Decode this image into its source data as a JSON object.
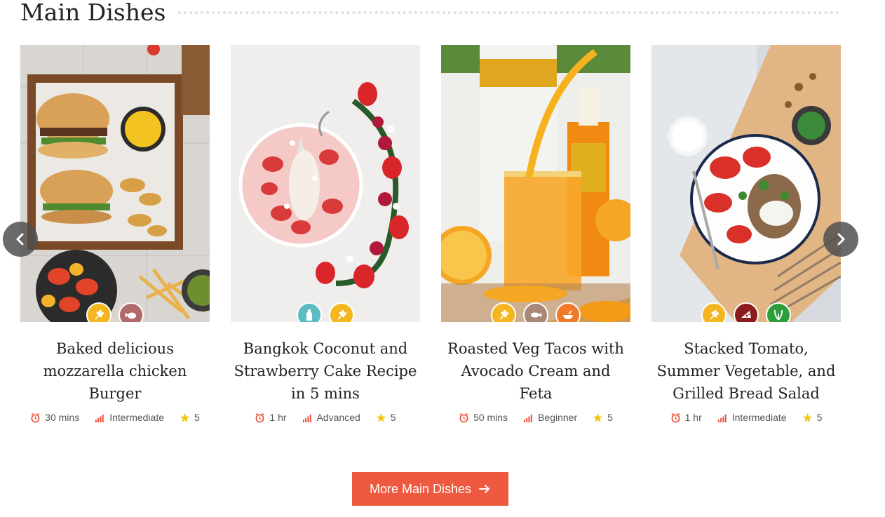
{
  "section": {
    "title": "Main Dishes"
  },
  "colors": {
    "accent": "#ee5a3f",
    "badge_yellow": "#f3b61f",
    "badge_teal": "#5bbcc2",
    "badge_mauve": "#b06a6a",
    "badge_taupe": "#a9887a",
    "badge_orange": "#f07a2a",
    "badge_darkred": "#8a1c1c",
    "badge_green": "#2e9e3a"
  },
  "cards": [
    {
      "title": "Baked delicious mozzarella chicken Burger",
      "time": "30 mins",
      "difficulty": "Intermediate",
      "rating": "5",
      "badges": [
        "wheat-icon",
        "chicken-icon"
      ]
    },
    {
      "title": "Bangkok Coconut and Strawberry Cake Recipe in 5 mins",
      "time": "1 hr",
      "difficulty": "Advanced",
      "rating": "5",
      "badges": [
        "milk-bottle-icon",
        "wheat-icon"
      ]
    },
    {
      "title": "Roasted Veg Tacos with Avocado Cream and Feta",
      "time": "50 mins",
      "difficulty": "Beginner",
      "rating": "5",
      "badges": [
        "wheat-icon",
        "fish-icon",
        "bowl-icon"
      ]
    },
    {
      "title": "Stacked Tomato, Summer Vegetable, and Grilled Bread Salad",
      "time": "1 hr",
      "difficulty": "Intermediate",
      "rating": "5",
      "badges": [
        "wheat-icon",
        "cheese-icon",
        "leaf-icon"
      ]
    }
  ],
  "more_button": {
    "label": "More Main Dishes"
  }
}
